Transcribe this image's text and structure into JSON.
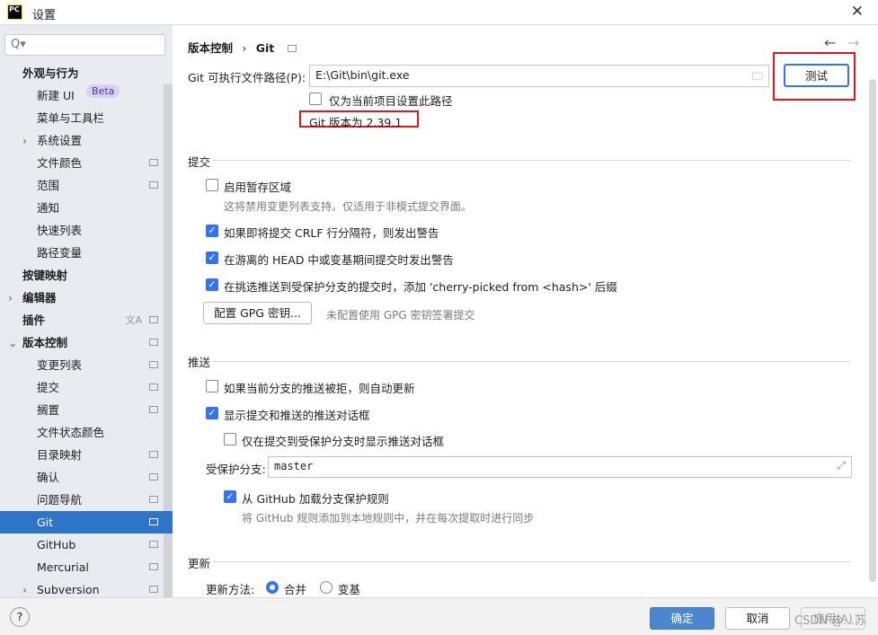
{
  "window": {
    "title": "设置",
    "logo": "PC"
  },
  "sidebar": {
    "search_placeholder": "Q▾",
    "items": [
      {
        "label": "外观与行为",
        "bold": true
      },
      {
        "label": "新建 UI",
        "badge": "Beta"
      },
      {
        "label": "菜单与工具栏"
      },
      {
        "label": "系统设置",
        "chevron": true
      },
      {
        "label": "文件颜色",
        "icon": true
      },
      {
        "label": "范围",
        "icon": true
      },
      {
        "label": "通知"
      },
      {
        "label": "快速列表"
      },
      {
        "label": "路径变量"
      },
      {
        "label": "按键映射",
        "bold": true
      },
      {
        "label": "编辑器",
        "bold": true,
        "chevron": true
      },
      {
        "label": "插件",
        "bold": true,
        "icon": true,
        "translate": true
      },
      {
        "label": "版本控制",
        "bold": true,
        "chevron": true,
        "expanded": true,
        "icon": true
      },
      {
        "label": "变更列表",
        "icon": true
      },
      {
        "label": "提交",
        "icon": true
      },
      {
        "label": "搁置",
        "icon": true
      },
      {
        "label": "文件状态颜色"
      },
      {
        "label": "目录映射",
        "icon": true
      },
      {
        "label": "确认",
        "icon": true
      },
      {
        "label": "问题导航",
        "icon": true
      },
      {
        "label": "Git",
        "icon": true,
        "selected": true
      },
      {
        "label": "GitHub",
        "icon": true
      },
      {
        "label": "Mercurial",
        "icon": true
      },
      {
        "label": "Subversion",
        "chevron": true,
        "icon": true
      }
    ]
  },
  "breadcrumb": {
    "parent": "版本控制",
    "sep": "›",
    "current": "Git"
  },
  "git": {
    "path_label": "Git 可执行文件路径(P):",
    "path_value": "E:\\Git\\bin\\git.exe",
    "test_button": "测试",
    "project_only": "仅为当前项目设置此路径",
    "version": "Git 版本为 2.39.1"
  },
  "commit": {
    "title": "提交",
    "staging": "启用暂存区域",
    "staging_hint": "这将禁用变更列表支持。仅适用于非模式提交界面。",
    "crlf": "如果即将提交 CRLF 行分隔符，则发出警告",
    "head": "在游离的 HEAD 中或变基期间提交时发出警告",
    "cherry": "在挑选推送到受保护分支的提交时，添加 'cherry-picked from <hash>' 后缀",
    "gpg_button": "配置 GPG 密钥...",
    "gpg_hint": "未配置使用 GPG 密钥签署提交"
  },
  "push": {
    "title": "推送",
    "auto_update": "如果当前分支的推送被拒，则自动更新",
    "show_dialog": "显示提交和推送的推送对话框",
    "protected_only": "仅在提交到受保护分支时显示推送对话框",
    "protected_label": "受保护分支:",
    "protected_value": "master",
    "github_rules": "从 GitHub 加载分支保护规则",
    "github_hint": "将 GitHub 规则添加到本地规则中，并在每次提取时进行同步"
  },
  "update": {
    "title": "更新",
    "method_label": "更新方法:",
    "merge": "合并",
    "rebase": "变基"
  },
  "footer": {
    "help": "?",
    "ok": "确定",
    "cancel": "取消",
    "apply": "应用(A)",
    "watermark": "CSDN @...苏"
  },
  "colors": {
    "accent": "#3574f0",
    "selected": "#2f75c7",
    "highlight": "#e8141a"
  }
}
